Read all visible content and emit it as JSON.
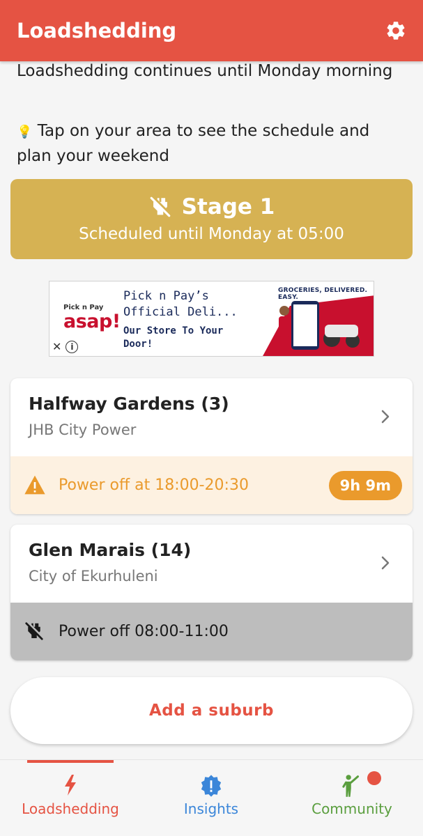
{
  "app": {
    "title": "Loadshedding"
  },
  "info": {
    "line1": "Loadshedding continues until Monday morning",
    "tip_icon": "💡",
    "line2": "Tap on your area to see the schedule and plan your weekend"
  },
  "stage": {
    "title": "Stage 1",
    "subtitle": "Scheduled until Monday at 05:00",
    "icon": "power-off-plug-icon",
    "color": "#d6b253"
  },
  "ad": {
    "brand_small": "Pick n Pay",
    "brand_big": "asap!",
    "headline": "Pick n Pay’s Official Deli...",
    "tagline": "Our Store To Your Door!",
    "banner_text": "GROCERIES, DELIVERED. EASY.",
    "close_label": "✕",
    "info_label": "i"
  },
  "areas": [
    {
      "name": "Halfway Gardens (3)",
      "provider": "JHB City Power",
      "status_text": "Power off at 18:00-20:30",
      "badge": "9h 9m",
      "status_icon": "warning-icon",
      "status_color": "#ea9a2c"
    },
    {
      "name": "Glen Marais (14)",
      "provider": "City of Ekurhuleni",
      "status_text": "Power off 08:00-11:00",
      "status_icon": "power-off-plug-icon",
      "status_color": "#bdbdbd"
    }
  ],
  "add_button": {
    "label": "Add a suburb"
  },
  "nav": {
    "items": [
      {
        "label": "Loadshedding",
        "icon": "lightning-icon",
        "color": "#e55343",
        "active": true
      },
      {
        "label": "Insights",
        "icon": "badge-alert-icon",
        "color": "#3b86d9",
        "active": false
      },
      {
        "label": "Community",
        "icon": "person-cheer-icon",
        "color": "#5a9e3e",
        "active": false
      }
    ]
  },
  "colors": {
    "primary": "#e55343",
    "warning": "#ea9a2c",
    "background": "#f5f5f5"
  }
}
